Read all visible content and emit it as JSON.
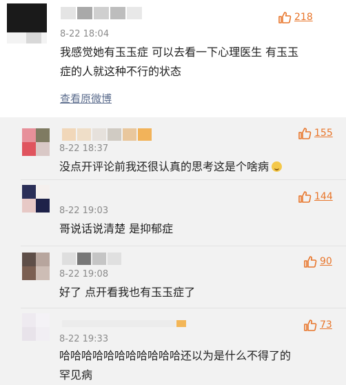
{
  "main": {
    "time": "8-22 18:04",
    "likes": "218",
    "text_line1": "我感觉她有玉玉症 可以去看一下心理医生 有玉玉",
    "text_line2": "症的人就这种不行的状态",
    "view_original": "查看原微博"
  },
  "replies": [
    {
      "time": "8-22 18:37",
      "likes": "155",
      "text": "没点开评论前我还很认真的思考这是个啥病"
    },
    {
      "time": "8-22 19:03",
      "likes": "144",
      "text": "哥说话说清楚 是抑郁症"
    },
    {
      "time": "8-22 19:08",
      "likes": "90",
      "text": "好了 点开看我也有玉玉症了"
    },
    {
      "time": "8-22 19:33",
      "likes": "73",
      "text_line1": "哈哈哈哈哈哈哈哈哈哈哈还以为是什么不得了的",
      "text_line2": "罕见病"
    }
  ],
  "colors": {
    "accent": "#e8752a",
    "link": "#5b6c8d",
    "reply_bg": "#f2f2f2"
  },
  "icons": {
    "like": "thumbs-up-icon",
    "emoji": "laughing-emoji-icon"
  }
}
